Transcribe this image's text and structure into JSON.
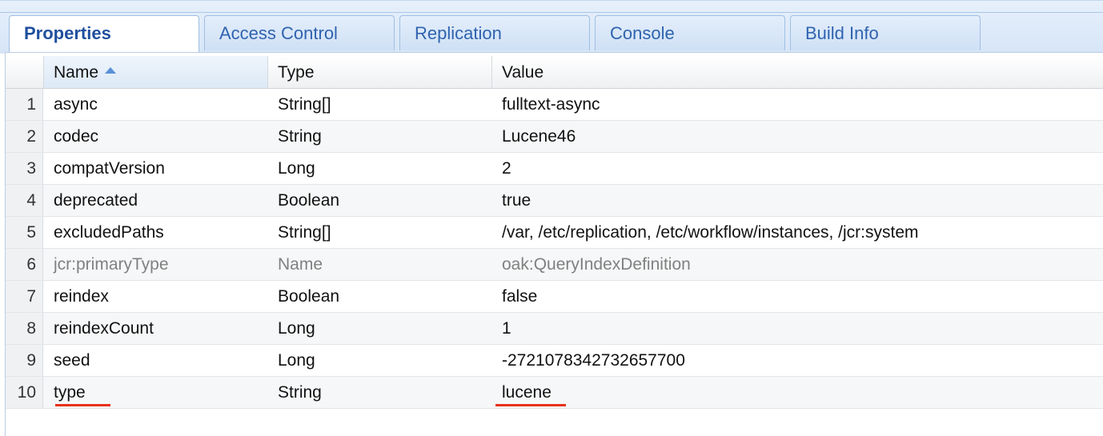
{
  "tabs": [
    {
      "label": "Properties",
      "active": true
    },
    {
      "label": "Access Control",
      "active": false
    },
    {
      "label": "Replication",
      "active": false
    },
    {
      "label": "Console",
      "active": false
    },
    {
      "label": "Build Info",
      "active": false
    }
  ],
  "table": {
    "headers": {
      "name": "Name",
      "type": "Type",
      "value": "Value"
    },
    "sort": {
      "column": "Name",
      "direction": "ascending"
    },
    "rows": [
      {
        "num": "1",
        "name": "async",
        "type": "String[]",
        "value": "fulltext-async"
      },
      {
        "num": "2",
        "name": "codec",
        "type": "String",
        "value": "Lucene46"
      },
      {
        "num": "3",
        "name": "compatVersion",
        "type": "Long",
        "value": "2"
      },
      {
        "num": "4",
        "name": "deprecated",
        "type": "Boolean",
        "value": "true"
      },
      {
        "num": "5",
        "name": "excludedPaths",
        "type": "String[]",
        "value": "/var, /etc/replication, /etc/workflow/instances, /jcr:system"
      },
      {
        "num": "6",
        "name": "jcr:primaryType",
        "type": "Name",
        "value": "oak:QueryIndexDefinition"
      },
      {
        "num": "7",
        "name": "reindex",
        "type": "Boolean",
        "value": "false"
      },
      {
        "num": "8",
        "name": "reindexCount",
        "type": "Long",
        "value": "1"
      },
      {
        "num": "9",
        "name": "seed",
        "type": "Long",
        "value": "-2721078342732657700"
      },
      {
        "num": "10",
        "name": "type",
        "type": "String",
        "value": "lucene"
      }
    ]
  },
  "colors": {
    "accent": "#1f4f9e",
    "annotation": "#e8321a",
    "protected_text": "#808080"
  }
}
